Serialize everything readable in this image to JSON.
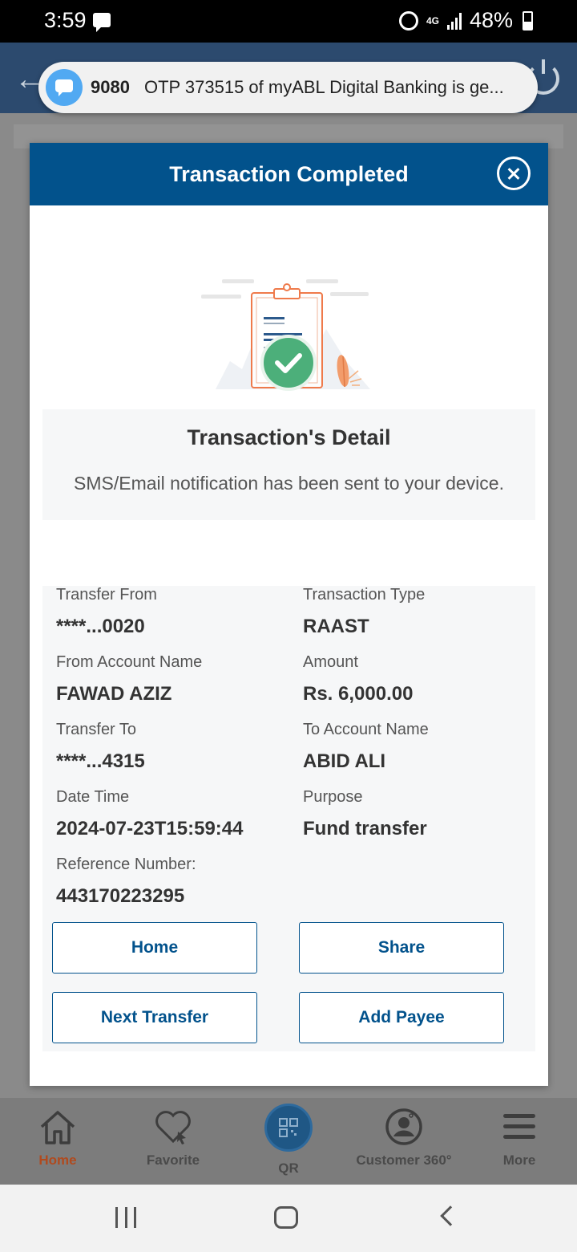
{
  "status_bar": {
    "time": "3:59",
    "network": "4G",
    "battery": "48%"
  },
  "notification": {
    "sender": "9080",
    "text": "OTP 373515 of myABL Digital Banking is ge..."
  },
  "modal": {
    "title": "Transaction Completed",
    "detail_title": "Transaction's Detail",
    "detail_subtitle": "SMS/Email notification has been sent to your device."
  },
  "fields": {
    "transfer_from": {
      "label": "Transfer From",
      "value": "****...0020"
    },
    "transaction_type": {
      "label": "Transaction Type",
      "value": "RAAST"
    },
    "from_account_name": {
      "label": "From Account Name",
      "value": "FAWAD AZIZ"
    },
    "amount": {
      "label": "Amount",
      "value": "Rs. 6,000.00"
    },
    "transfer_to": {
      "label": "Transfer To",
      "value": "****...4315"
    },
    "to_account_name": {
      "label": "To Account Name",
      "value": "ABID ALI"
    },
    "date_time": {
      "label": "Date Time",
      "value": "2024-07-23T15:59:44"
    },
    "purpose": {
      "label": "Purpose",
      "value": "Fund transfer"
    },
    "reference_number": {
      "label": "Reference Number:",
      "value": "443170223295"
    }
  },
  "buttons": {
    "home": "Home",
    "share": "Share",
    "next_transfer": "Next Transfer",
    "add_payee": "Add Payee"
  },
  "bottom_nav": {
    "items": [
      {
        "label": "Home",
        "icon": "home-icon",
        "active": true
      },
      {
        "label": "Favorite",
        "icon": "heart-icon"
      },
      {
        "label": "QR",
        "icon": "qr-icon"
      },
      {
        "label": "Customer 360°",
        "icon": "customer-icon"
      },
      {
        "label": "More",
        "icon": "menu-icon"
      }
    ]
  },
  "colors": {
    "primary": "#02528c",
    "active_nav": "#b04a1e",
    "success": "#4caf7a"
  }
}
